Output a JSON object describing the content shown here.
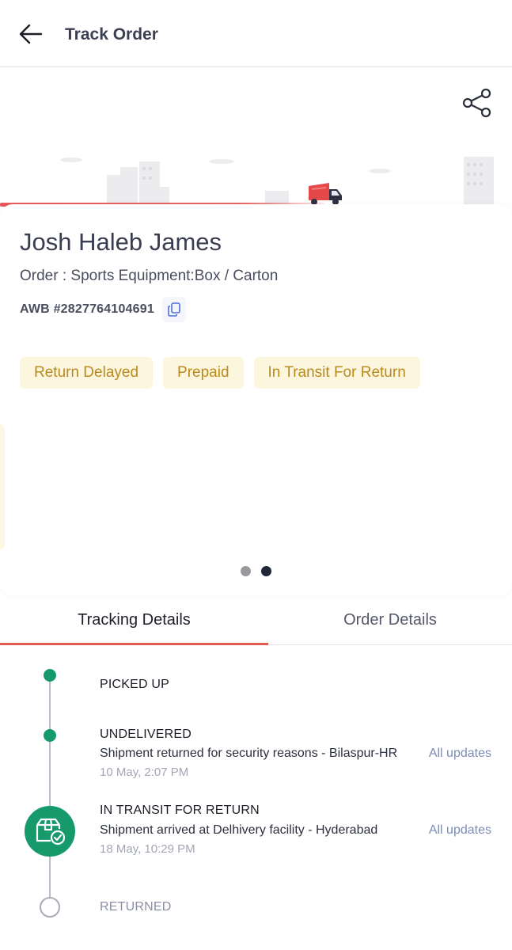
{
  "header": {
    "title": "Track Order"
  },
  "order": {
    "customer_name": "Josh Haleb James",
    "description": "Order : Sports Equipment:Box / Carton",
    "awb": "AWB #2827764104691",
    "tags": [
      "Return Delayed",
      "Prepaid",
      "In Transit For Return"
    ]
  },
  "carousel": {
    "page_count": 2,
    "active_page": 2
  },
  "tabs": {
    "tracking": "Tracking Details",
    "order": "Order Details",
    "active": "tracking"
  },
  "timeline": [
    {
      "status": "PICKED UP",
      "description": "",
      "time": "",
      "link": "",
      "state": "done"
    },
    {
      "status": "UNDELIVERED",
      "description": "Shipment returned for security reasons - Bilaspur-HR",
      "time": "10 May, 2:07 PM",
      "link": "All updates",
      "state": "done"
    },
    {
      "status": "IN TRANSIT FOR RETURN",
      "description": "Shipment arrived at Delhivery facility - Hyderabad",
      "time": "18 May, 10:29 PM",
      "link": "All updates",
      "state": "current"
    },
    {
      "status": "RETURNED",
      "description": "",
      "time": "",
      "link": "",
      "state": "pending"
    }
  ],
  "icons": {
    "back": "arrow-left-icon",
    "share": "share-icon",
    "copy": "copy-icon",
    "truck": "delivery-truck-icon",
    "package": "package-check-icon"
  },
  "colors": {
    "accent_red": "#e45a51",
    "status_green": "#169a6c",
    "tag_bg": "#fdf6df",
    "tag_text": "#b98a1c",
    "link": "#7b8cb6"
  }
}
